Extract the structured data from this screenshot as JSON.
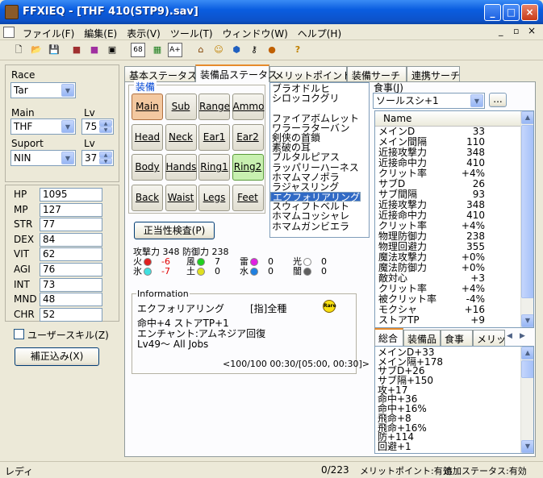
{
  "window": {
    "title": "FFXIEQ - [THF 410(STP9).sav]",
    "min": "_",
    "max": "□",
    "close": "×"
  },
  "menu": [
    "ファイル(F)",
    "編集(E)",
    "表示(V)",
    "ツール(T)",
    "ウィンドウ(W)",
    "ヘルプ(H)"
  ],
  "mdi_controls": [
    "_",
    "▫",
    "×"
  ],
  "toolbar": [
    "new-icon",
    "open-icon",
    "save-icon",
    "tool1-icon",
    "tool2-icon",
    "tool3-icon",
    "68",
    "grid-icon",
    "A+",
    "house-icon",
    "face-icon",
    "gem-icon",
    "key-icon",
    "food-icon",
    "help-icon"
  ],
  "toolbar_labels": {
    "t68": "68",
    "taplus": "A+",
    "help": "?"
  },
  "left": {
    "race_label": "Race",
    "race_value": "Tar",
    "main_label": "Main",
    "main_value": "THF",
    "main_lv_label": "Lv",
    "main_lv": "75",
    "support_label": "Suport",
    "support_value": "NIN",
    "support_lv_label": "Lv",
    "support_lv": "37",
    "stats": [
      {
        "name": "HP",
        "value": "1095"
      },
      {
        "name": "MP",
        "value": "127"
      },
      {
        "name": "STR",
        "value": "77"
      },
      {
        "name": "DEX",
        "value": "84"
      },
      {
        "name": "VIT",
        "value": "62"
      },
      {
        "name": "AGI",
        "value": "76"
      },
      {
        "name": "INT",
        "value": "73"
      },
      {
        "name": "MND",
        "value": "48"
      },
      {
        "name": "CHR",
        "value": "52"
      }
    ],
    "user_skill": "ユーザースキル(Z)",
    "correction_button": "補正込み(X)"
  },
  "tabs": [
    "基本ステータス",
    "装備品ステータス",
    "メリットポイント",
    "装備サーチ",
    "連携サーチ"
  ],
  "equip": {
    "group_label": "装備",
    "slots": [
      "Main",
      "Sub",
      "Range",
      "Ammo",
      "Head",
      "Neck",
      "Ear1",
      "Ear2",
      "Body",
      "Hands",
      "Ring1",
      "Ring2",
      "Back",
      "Waist",
      "Legs",
      "Feet"
    ],
    "validity_button": "正当性検査(P)",
    "atk_def": "攻撃力 348 防御力 238",
    "elements": [
      {
        "label": "火",
        "value": "-6",
        "color": "#e02020",
        "negative": true
      },
      {
        "label": "風",
        "value": "7",
        "color": "#20d020",
        "negative": false
      },
      {
        "label": "雷",
        "value": "0",
        "color": "#e020e0",
        "negative": false
      },
      {
        "label": "光",
        "value": "0",
        "color": "#ffffff",
        "negative": false
      },
      {
        "label": "氷",
        "value": "-7",
        "color": "#40e0e0",
        "negative": true
      },
      {
        "label": "土",
        "value": "0",
        "color": "#e0e020",
        "negative": false
      },
      {
        "label": "水",
        "value": "0",
        "color": "#2080e0",
        "negative": false
      },
      {
        "label": "闇",
        "value": "0",
        "color": "#606060",
        "negative": false
      }
    ]
  },
  "item_list": [
    "ブラオドルヒ",
    "シロッコクグリ",
    "",
    "ファイアボムレット",
    "ワラーラターバン",
    "剣侠の首鎖",
    "素破の耳",
    "ブルタルピアス",
    "ラッパリーハーネス",
    "ホマムマノポラ",
    "ラジャスリング",
    "エクフォリアリング",
    "仙道の外套",
    "スウィフトベルト",
    "ホマムコッシャレ",
    "ホマムガンビエラ"
  ],
  "item_selected_index": 11,
  "info": {
    "label": "Information",
    "name": "エクフォリアリング",
    "type": "[指]全種",
    "rare": "Rare",
    "line1": "命中+4 ストアTP+1",
    "line2": "エンチャント:アムネジア回復",
    "line3": "Lv49〜 All Jobs",
    "footer": "<100/100 00:30/[05:00, 00:30]>"
  },
  "food": {
    "label": "食事(J)",
    "value": "ソールスシ+1",
    "button": "..."
  },
  "status_table": {
    "header": "Name",
    "rows": [
      {
        "name": "メインD",
        "value": "33"
      },
      {
        "name": "メイン間隔",
        "value": "110"
      },
      {
        "name": "近接攻撃力",
        "value": "348"
      },
      {
        "name": "近接命中力",
        "value": "410"
      },
      {
        "name": "クリット率",
        "value": "+4%"
      },
      {
        "name": "サブD",
        "value": "26"
      },
      {
        "name": "サブ間隔",
        "value": "93"
      },
      {
        "name": "近接攻撃力",
        "value": "348"
      },
      {
        "name": "近接命中力",
        "value": "410"
      },
      {
        "name": "クリット率",
        "value": "+4%"
      },
      {
        "name": "物理防御力",
        "value": "238"
      },
      {
        "name": "物理回避力",
        "value": "355"
      },
      {
        "name": "魔法攻撃力",
        "value": "+0%"
      },
      {
        "name": "魔法防御力",
        "value": "+0%"
      },
      {
        "name": "敵対心",
        "value": "+3"
      },
      {
        "name": "クリット率",
        "value": "+4%"
      },
      {
        "name": "被クリット率",
        "value": "-4%"
      },
      {
        "name": "モクシャ",
        "value": "+16"
      },
      {
        "name": "ストアTP",
        "value": "+9"
      }
    ]
  },
  "bottom_tabs": [
    "総合",
    "装備品",
    "食事",
    "メリット"
  ],
  "summary": [
    "メインD+33",
    "メイン隔+178",
    "サブD+26",
    "サブ隔+150",
    "攻+17",
    "命中+36",
    "命中+16%",
    "飛命+8",
    "飛命+16%",
    "防+114",
    "回避+1"
  ],
  "status": {
    "ready": "レディ",
    "count": "0/223",
    "merit": "メリットポイント:有効",
    "extra": "追加ステータス:有効"
  }
}
